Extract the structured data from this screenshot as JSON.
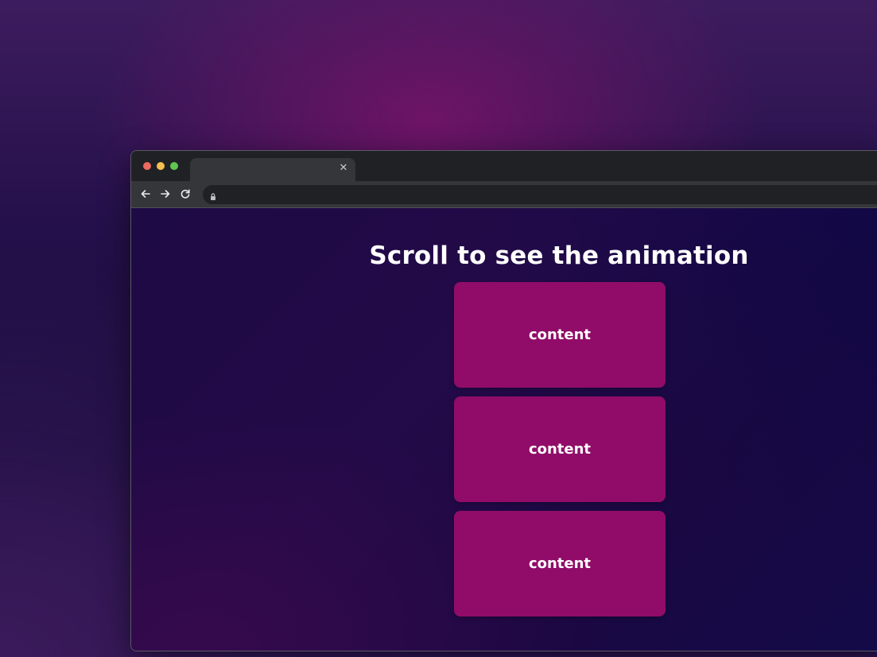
{
  "page": {
    "title": "Scroll to see the animation"
  },
  "browser": {
    "tab": {
      "title": "",
      "close_icon": "close-icon"
    },
    "toolbar": {
      "back_icon": "arrow-left-icon",
      "forward_icon": "arrow-right-icon",
      "reload_icon": "reload-icon",
      "lock_icon": "lock-icon",
      "url": ""
    }
  },
  "cards": [
    {
      "label": "content"
    },
    {
      "label": "content"
    },
    {
      "label": "content"
    }
  ],
  "colors": {
    "card_background": "#900c68",
    "page_background": "#1e0a45",
    "title_text": "#ffffff"
  }
}
